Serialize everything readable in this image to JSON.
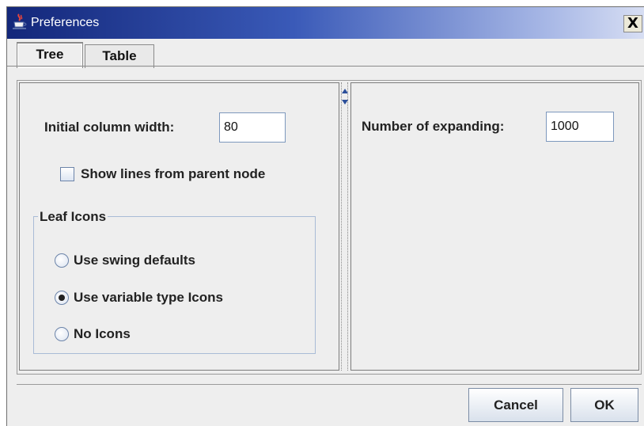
{
  "window": {
    "title": "Preferences",
    "close_glyph": "X",
    "title_icon": "java-cup-icon"
  },
  "tabs": [
    {
      "label": "Tree",
      "active": true
    },
    {
      "label": "Table",
      "active": false
    }
  ],
  "left_panel": {
    "column_width_label": "Initial column width:",
    "column_width_value": "80",
    "show_lines_label": "Show lines from parent node",
    "show_lines_checked": false,
    "leaf_icons": {
      "legend": "Leaf Icons",
      "options": [
        {
          "label": "Use swing defaults",
          "selected": false
        },
        {
          "label": "Use variable type Icons",
          "selected": true
        },
        {
          "label": "No Icons",
          "selected": false
        }
      ]
    }
  },
  "right_panel": {
    "expanding_label": "Number of expanding:",
    "expanding_value": "1000"
  },
  "buttons": {
    "cancel": "Cancel",
    "ok": "OK"
  }
}
